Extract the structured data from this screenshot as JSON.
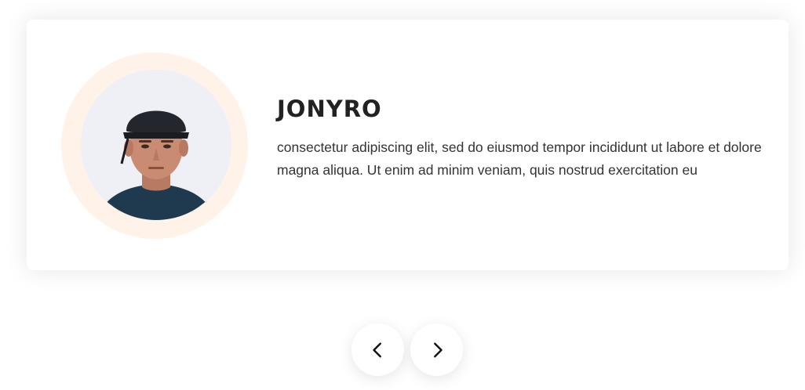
{
  "testimonial": {
    "name": "JONYRO",
    "text": "consectetur adipiscing elit, sed do eiusmod tempor incididunt ut labore et dolore magna aliqua. Ut enim ad minim veniam, quis nostrud exercitation eu"
  },
  "navigation": {
    "prev_icon": "chevron-left-icon",
    "next_icon": "chevron-right-icon"
  },
  "colors": {
    "ring": "#fff2e8",
    "text": "#333333",
    "heading": "#222222"
  }
}
